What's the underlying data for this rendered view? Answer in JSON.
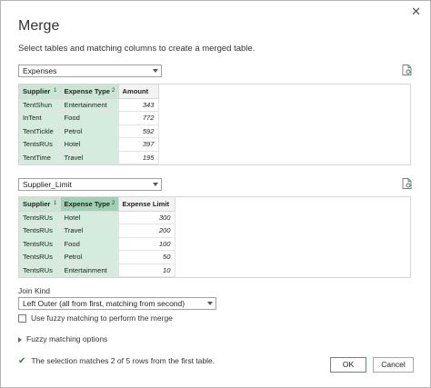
{
  "dialog": {
    "title": "Merge",
    "subtitle": "Select tables and matching columns to create a merged table.",
    "close_glyph": "✕"
  },
  "table1": {
    "selected": "Expenses",
    "columns": [
      {
        "name": "Supplier",
        "badge": "1"
      },
      {
        "name": "Expense Type",
        "badge": "2"
      },
      {
        "name": "Amount",
        "badge": ""
      }
    ],
    "rows": [
      [
        "TentShun",
        "Entertainment",
        "343"
      ],
      [
        "InTent",
        "Food",
        "772"
      ],
      [
        "TentTickle",
        "Petrol",
        "592"
      ],
      [
        "TentsRUs",
        "Hotel",
        "397"
      ],
      [
        "TentTime",
        "Travel",
        "195"
      ]
    ]
  },
  "table2": {
    "selected": "Supplier_Limit",
    "columns": [
      {
        "name": "Supplier",
        "badge": "1"
      },
      {
        "name": "Expense Type",
        "badge": "2"
      },
      {
        "name": "Expense Limit",
        "badge": ""
      }
    ],
    "rows": [
      [
        "TentsRUs",
        "Hotel",
        "300"
      ],
      [
        "TentsRUs",
        "Travel",
        "200"
      ],
      [
        "TentsRUs",
        "Food",
        "100"
      ],
      [
        "TentsRUs",
        "Petrol",
        "50"
      ],
      [
        "TentsRUs",
        "Entertainment",
        "10"
      ]
    ]
  },
  "join": {
    "label": "Join Kind",
    "selected": "Left Outer (all from first, matching from second)"
  },
  "fuzzy": {
    "checkbox_label": "Use fuzzy matching to perform the merge",
    "checked": false,
    "options_label": "Fuzzy matching options"
  },
  "status": {
    "message": "The selection matches 2 of 5 rows from the first table."
  },
  "buttons": {
    "ok": "OK",
    "cancel": "Cancel"
  },
  "colors": {
    "selected_column": "#d4ecde",
    "selected_header": "#9dd3b2",
    "check": "#2e7d4f"
  }
}
